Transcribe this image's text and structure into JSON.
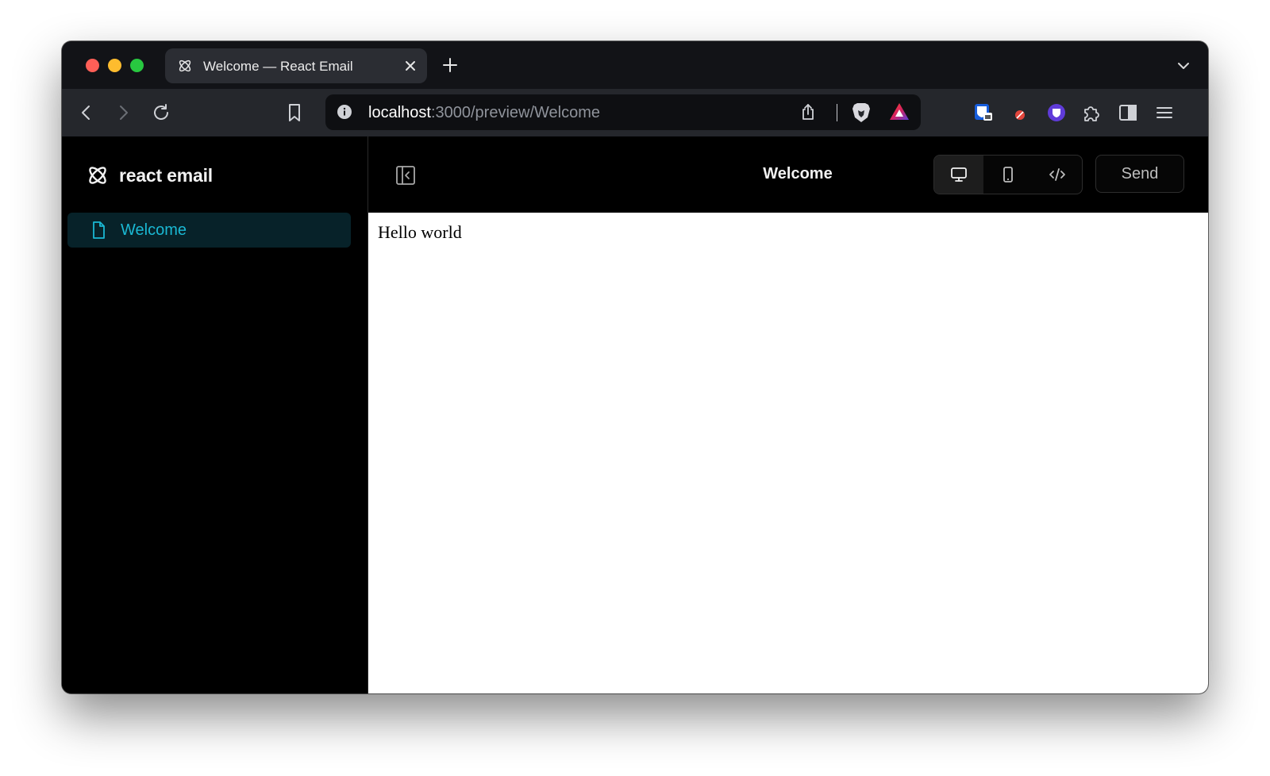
{
  "browser": {
    "tab": {
      "title": "Welcome — React Email"
    },
    "address": {
      "host": "localhost",
      "rest": ":3000/preview/Welcome"
    }
  },
  "icons": {
    "favicon": "react-email-logo-icon",
    "back": "chevron-left-icon",
    "forward": "chevron-right-icon",
    "reload": "reload-icon",
    "bookmark": "bookmark-icon",
    "info": "info-icon",
    "share": "share-icon",
    "brave_shields": "brave-lion-icon",
    "brave_rewards": "rewards-triangle-icon",
    "extensions": [
      "bitwarden-icon",
      "ublock-icon",
      "vpn-shield-icon",
      "puzzle-icon"
    ],
    "sidebar": "sidebar-icon",
    "menu": "hamburger-icon"
  },
  "sidebar": {
    "brand": "react email",
    "items": [
      {
        "label": "Welcome",
        "active": true
      }
    ]
  },
  "header": {
    "title": "Welcome",
    "view_modes": [
      "desktop",
      "mobile",
      "code"
    ],
    "active_view": "desktop",
    "send_label": "Send"
  },
  "preview": {
    "body_text": "Hello world"
  },
  "colors": {
    "accent": "#1ab8d3",
    "active_item_bg": "#072229",
    "tab_bg": "#2b2d33",
    "toolbar_bg": "#25272c"
  }
}
